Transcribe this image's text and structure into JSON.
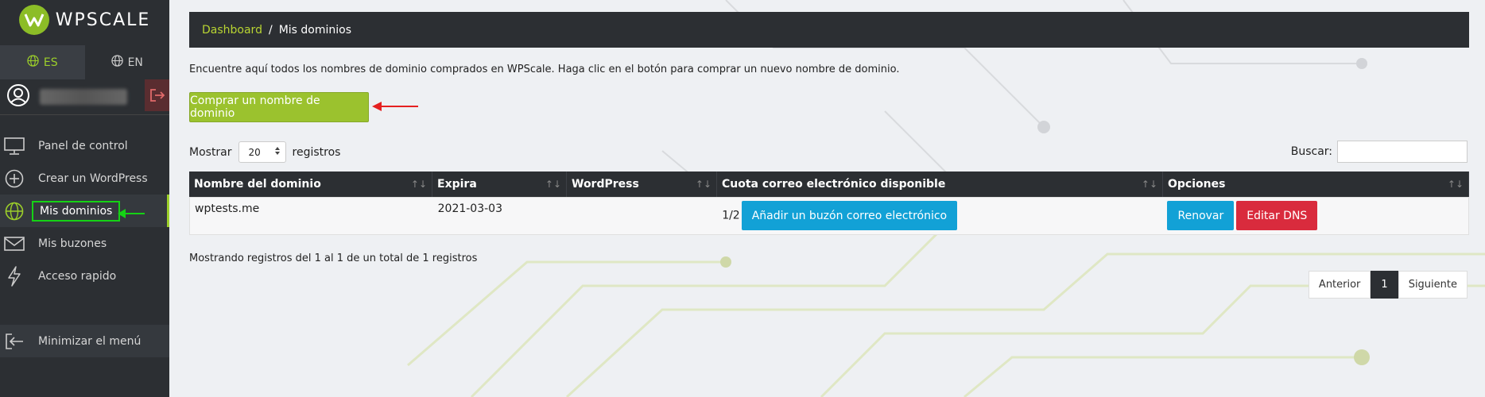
{
  "brand": {
    "name": "WPSCALE"
  },
  "languages": [
    {
      "label": "ES",
      "active": true
    },
    {
      "label": "EN",
      "active": false
    }
  ],
  "nav": {
    "items": [
      {
        "label": "Panel de control",
        "icon": "monitor-icon"
      },
      {
        "label": "Crear un WordPress",
        "icon": "plus-circle-icon"
      },
      {
        "label": "Mis dominios",
        "icon": "globe-icon",
        "active": true
      },
      {
        "label": "Mis buzones",
        "icon": "envelope-icon"
      },
      {
        "label": "Acceso rapido",
        "icon": "bolt-icon"
      }
    ],
    "minimize_label": "Minimizar el menú"
  },
  "breadcrumb": {
    "root": "Dashboard",
    "sep": "/",
    "current": "Mis dominios"
  },
  "intro_text": "Encuentre aquí todos los nombres de dominio comprados en WPScale. Haga clic en el botón para comprar un nuevo nombre de dominio.",
  "buy_button": "Comprar un nombre de dominio",
  "table_controls": {
    "show_label": "Mostrar",
    "page_size": "20",
    "records_label": "registros",
    "search_label": "Buscar:"
  },
  "table": {
    "headers": [
      "Nombre del dominio",
      "Expira",
      "WordPress",
      "Cuota correo electrónico disponible",
      "Opciones"
    ],
    "rows": [
      {
        "domain": "wptests.me",
        "expires": "2021-03-03",
        "wordpress": "",
        "quota": "1/2",
        "mail_button": "Añadir un buzón correo electrónico",
        "renew_button": "Renovar",
        "dns_button": "Editar DNS"
      }
    ]
  },
  "records_info": "Mostrando registros del 1 al 1 de un total de 1 registros",
  "pagination": {
    "prev": "Anterior",
    "current": "1",
    "next": "Siguiente"
  },
  "colors": {
    "accent": "#9bc22e",
    "primary_btn": "#12a1d6",
    "danger_btn": "#d92b3d",
    "sidebar": "#2c2f33"
  }
}
